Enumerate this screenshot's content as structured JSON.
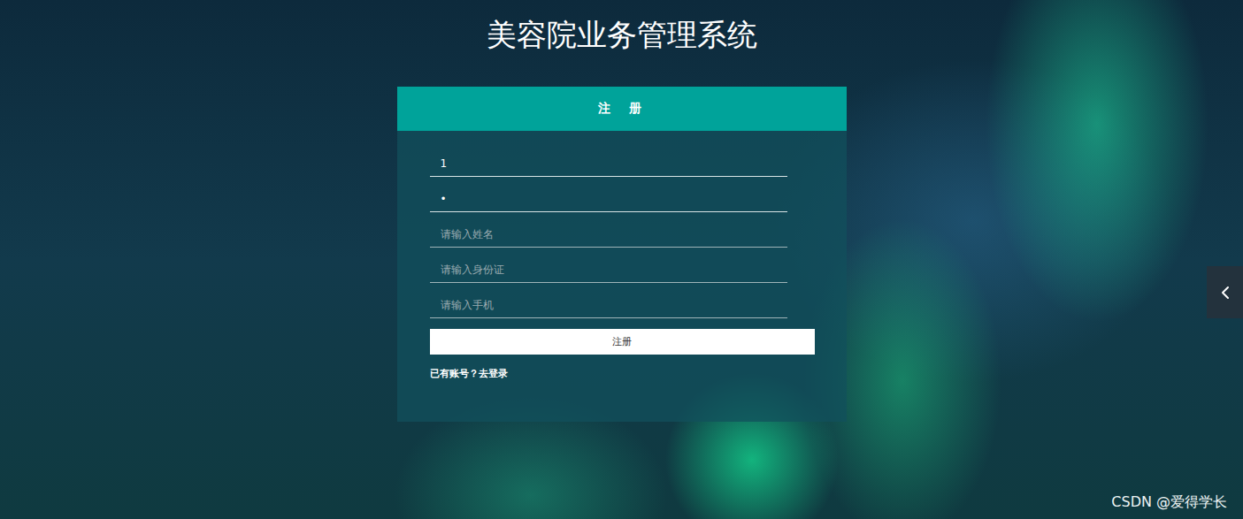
{
  "page": {
    "title": "美容院业务管理系统"
  },
  "form": {
    "title": "注 册",
    "fields": [
      {
        "kind": "text",
        "value": "1",
        "placeholder": "",
        "focused": false
      },
      {
        "kind": "password",
        "value": "•",
        "placeholder": "",
        "focused": false
      },
      {
        "kind": "text",
        "value": "",
        "placeholder": "请输入姓名",
        "focused": true
      },
      {
        "kind": "text",
        "value": "",
        "placeholder": "请输入身份证",
        "focused": false
      },
      {
        "kind": "text",
        "value": "",
        "placeholder": "请输入手机",
        "focused": false
      }
    ],
    "submit": "注册",
    "login_link": "已有账号？去登录"
  },
  "watermark": "CSDN @爱得学长"
}
